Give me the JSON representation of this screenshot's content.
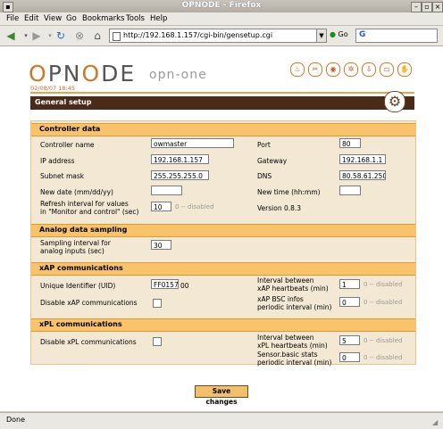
{
  "window": {
    "title": "OPNODE - Firefox"
  },
  "menu": [
    "File",
    "Edit",
    "View",
    "Go",
    "Bookmarks",
    "Tools",
    "Help"
  ],
  "toolbar": {
    "url": "http://192.168.1.157/cgi-bin/gensetup.cgi",
    "go_label": "Go",
    "search_value": "G"
  },
  "header": {
    "logo_main": "OPNODE",
    "logo_sub": "opn-one",
    "datetime": "02/08/07 18:45"
  },
  "page": {
    "section_title": "General setup"
  },
  "controller": {
    "title": "Controller data",
    "name_label": "Controller name",
    "name_value": "owmaster",
    "port_label": "Port",
    "port_value": "80",
    "ip_label": "IP address",
    "ip_value": "192.168.1.157",
    "gateway_label": "Gateway",
    "gateway_value": "192.168.1.1",
    "subnet_label": "Subnet mask",
    "subnet_value": "255.255.255.0",
    "dns_label": "DNS",
    "dns_value": "80.58.61.250",
    "date_label": "New date (mm/dd/yy)",
    "date_value": "",
    "time_label": "New time (hh:mm)",
    "time_value": "",
    "refresh_label_1": "Refresh interval for values",
    "refresh_label_2": "in \"Monitor and control\" (sec)",
    "refresh_value": "10",
    "refresh_hint": "0 -- disabled",
    "version": "Version 0.8.3"
  },
  "analog": {
    "title": "Analog data sampling",
    "sampling_label_1": "Sampling interval for",
    "sampling_label_2": "analog inputs (sec)",
    "sampling_value": "30"
  },
  "xap": {
    "title": "xAP communications",
    "uid_label": "Unique Identifier (UID)",
    "uid_value": "FF0157",
    "uid_suffix": "00",
    "hb_label_1": "Interval between",
    "hb_label_2": "xAP heartbeats (min)",
    "hb_value": "1",
    "hb_hint": "0 -- disabled",
    "disable_label": "Disable xAP communications",
    "bsc_label_1": "xAP BSC infos",
    "bsc_label_2": "periodic interval (min)",
    "bsc_value": "0",
    "bsc_hint": "0 -- disabled"
  },
  "xpl": {
    "title": "xPL communications",
    "disable_label": "Disable xPL communications",
    "hb_label_1": "Interval between",
    "hb_label_2": "xPL heartbeats (min)",
    "hb_value": "5",
    "hb_hint": "0 -- disabled",
    "sensor_label_1": "Sensor.basic stats",
    "sensor_label_2": "periodic interval (min)",
    "sensor_value": "0",
    "sensor_hint": "0 -- disabled"
  },
  "actions": {
    "save_label": "Save changes"
  },
  "status": {
    "text": "Done"
  }
}
